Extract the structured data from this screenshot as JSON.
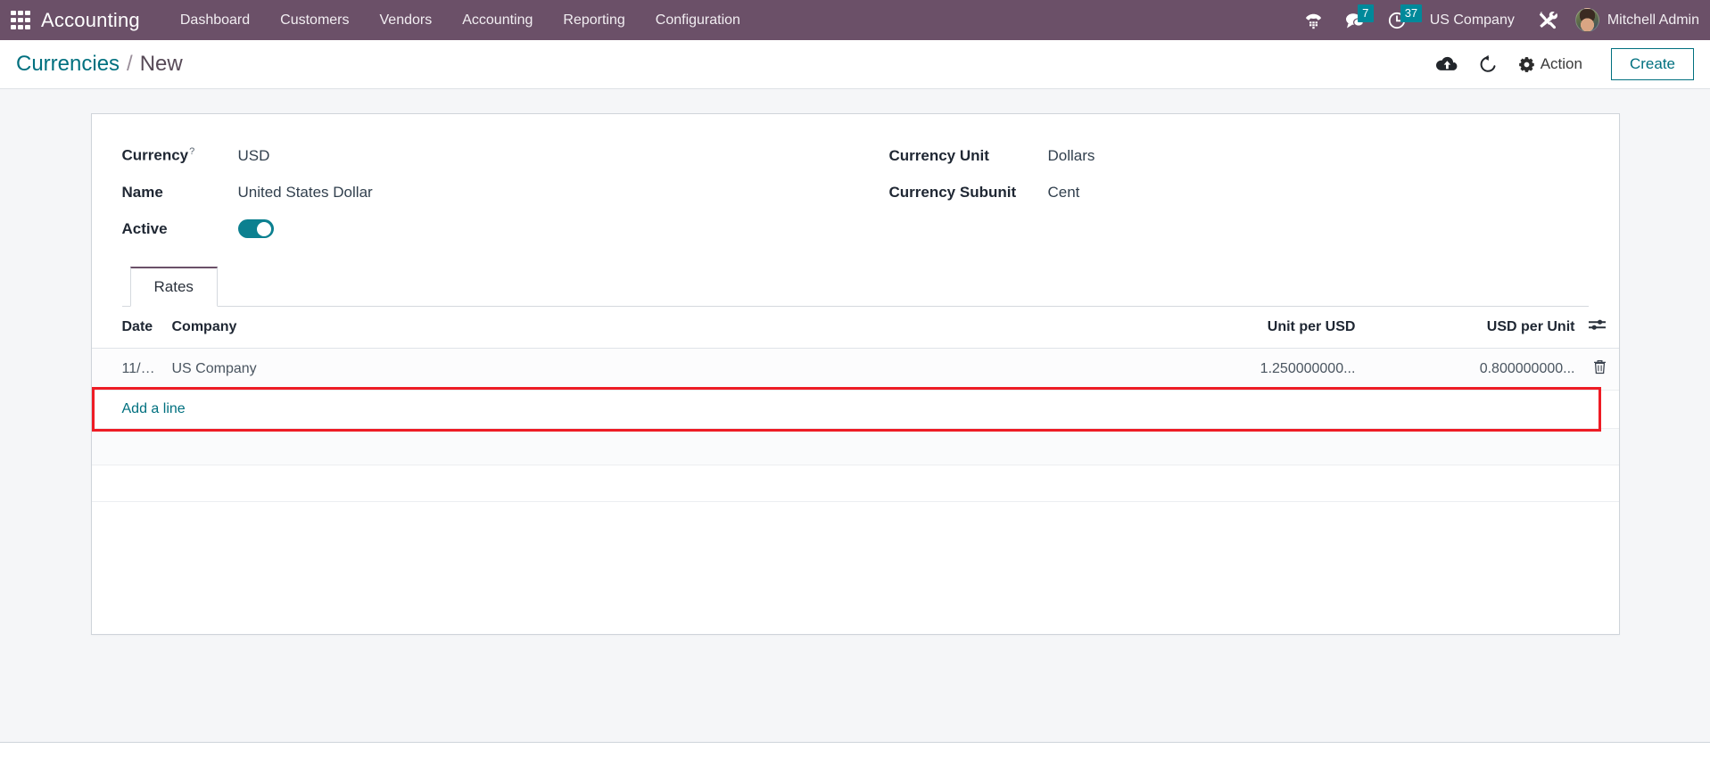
{
  "navbar": {
    "apps_icon": "apps-grid-icon",
    "brand": "Accounting",
    "menu": [
      {
        "label": "Dashboard"
      },
      {
        "label": "Customers"
      },
      {
        "label": "Vendors"
      },
      {
        "label": "Accounting"
      },
      {
        "label": "Reporting"
      },
      {
        "label": "Configuration"
      }
    ],
    "phone_icon": "phone-dialpad-icon",
    "messages": {
      "icon": "chat-bubble-icon",
      "count": "7"
    },
    "activities": {
      "icon": "clock-icon",
      "count": "37"
    },
    "company": "US Company",
    "tools_icon": "wrench-screwdriver-icon",
    "user": "Mitchell Admin",
    "bg_color": "#6b5068",
    "badge_color": "#00899a"
  },
  "control_panel": {
    "breadcrumb_parent": "Currencies",
    "breadcrumb_sep": "/",
    "breadcrumb_current": "New",
    "save_icon": "cloud-upload-icon",
    "discard_icon": "undo-icon",
    "action_icon": "gear-icon",
    "action_label": "Action",
    "create_label": "Create",
    "accent_color": "#00707f"
  },
  "form": {
    "left_fields": [
      {
        "label": "Currency",
        "tooltip": "?",
        "value": "USD",
        "type": "text"
      },
      {
        "label": "Name",
        "tooltip": "",
        "value": "United States Dollar",
        "type": "text"
      },
      {
        "label": "Active",
        "tooltip": "",
        "value": "on",
        "type": "toggle"
      }
    ],
    "right_fields": [
      {
        "label": "Currency Unit",
        "value": "Dollars"
      },
      {
        "label": "Currency Subunit",
        "value": "Cent"
      }
    ]
  },
  "notebook": {
    "tabs": [
      {
        "label": "Rates",
        "active": true
      }
    ]
  },
  "rates_table": {
    "columns": [
      "Date",
      "Company",
      "Unit per USD",
      "USD per Unit"
    ],
    "options_icon": "sliders-options-icon",
    "rows": [
      {
        "date": "11/10/2...",
        "company": "US Company",
        "unit_per_usd": "1.250000000...",
        "usd_per_unit": "0.800000000...",
        "delete_icon": "trash-icon"
      }
    ],
    "add_line_label": "Add a line"
  },
  "annotation": {
    "highlight_color": "#ee1c25",
    "target": "rates-row-1"
  }
}
